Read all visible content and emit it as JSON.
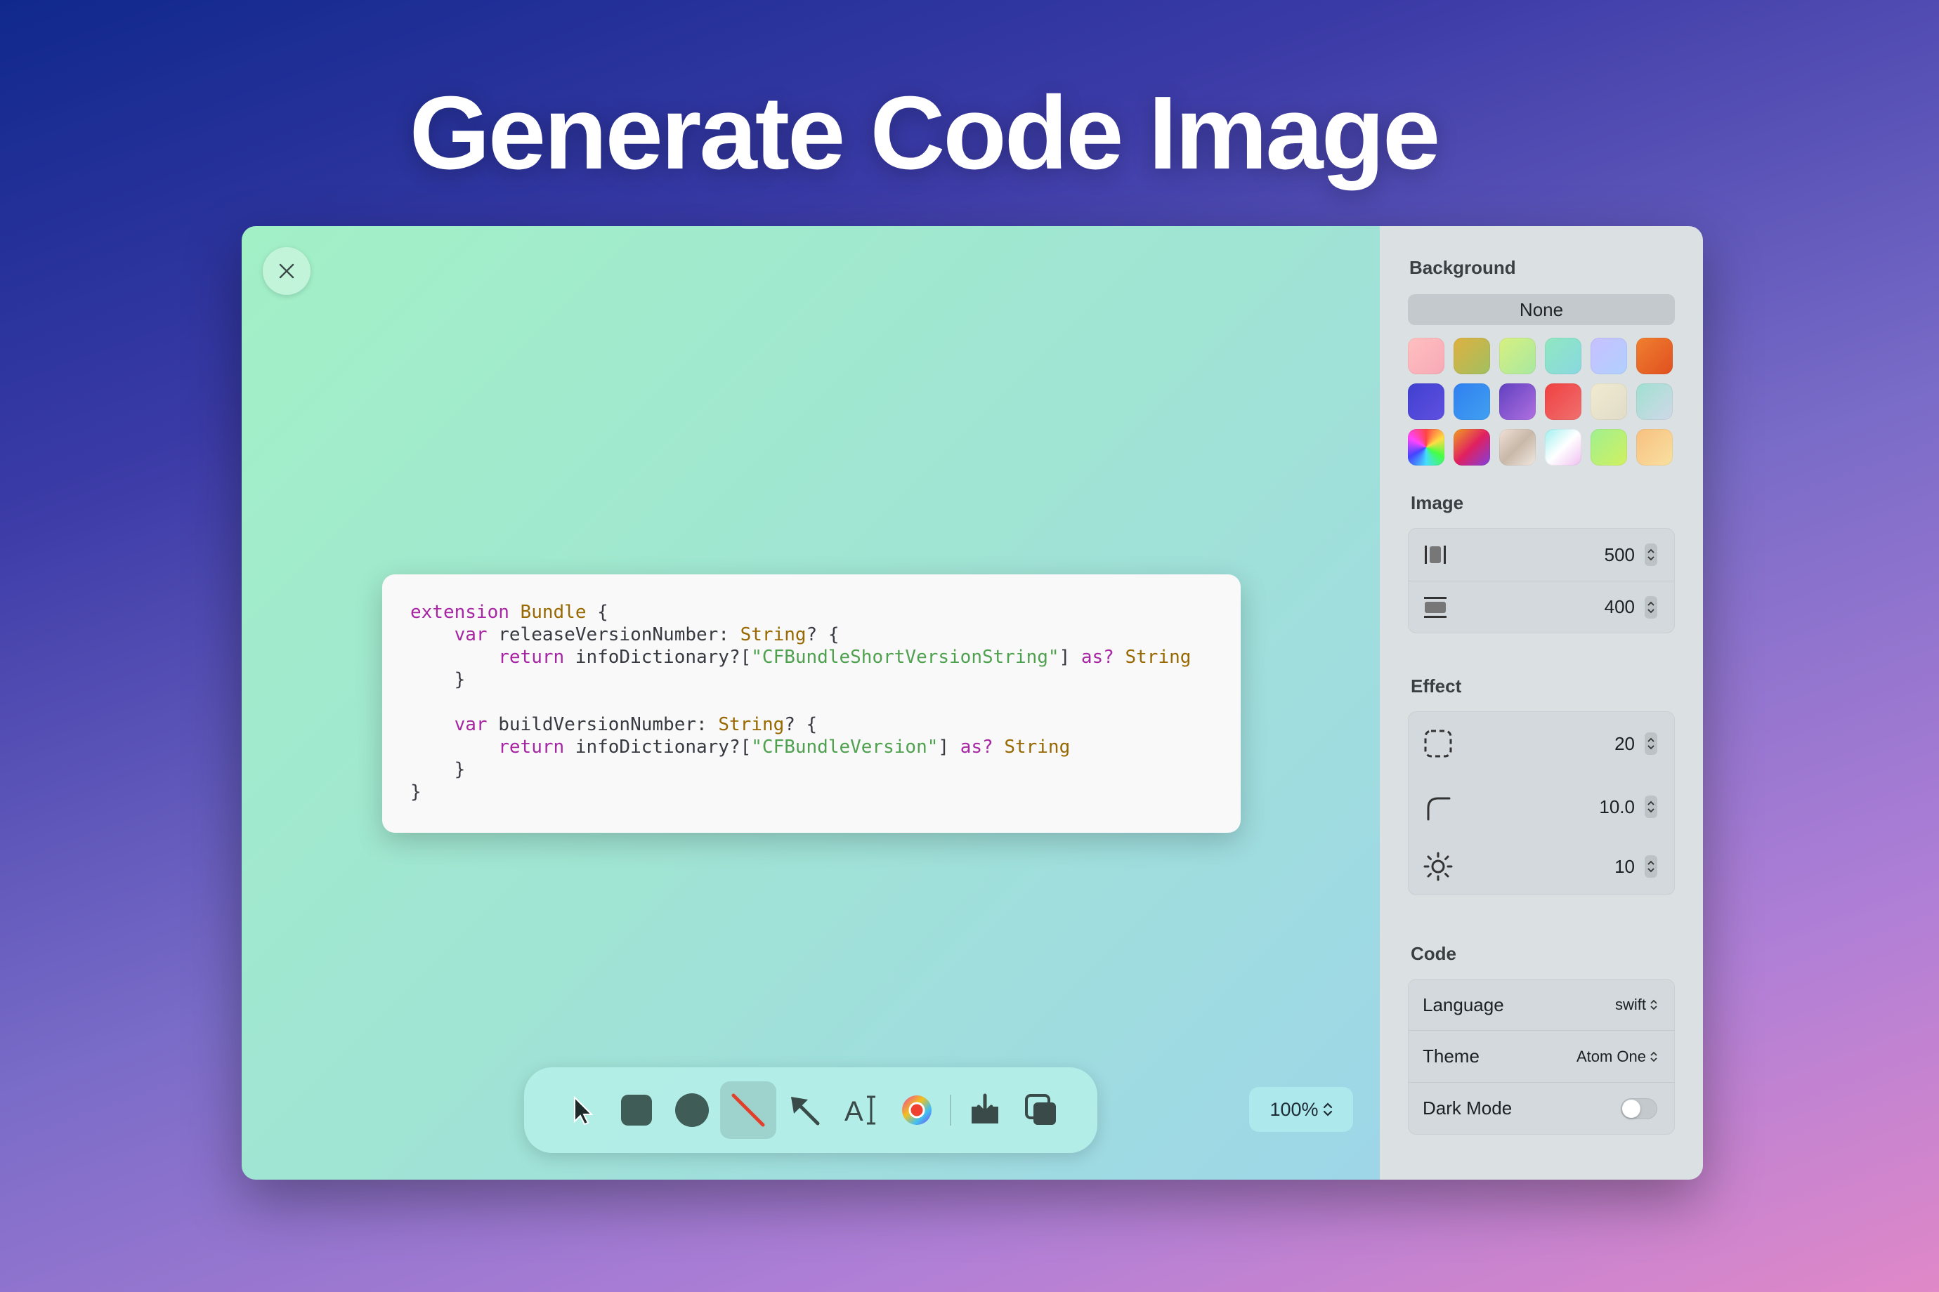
{
  "headline": "Generate Code Image",
  "code_lines": [
    [
      [
        "kw",
        "extension"
      ],
      [
        "p",
        " "
      ],
      [
        "ty",
        "Bundle"
      ],
      [
        "p",
        " {"
      ]
    ],
    [
      [
        "p",
        "    "
      ],
      [
        "kw",
        "var"
      ],
      [
        "p",
        " releaseVersionNumber: "
      ],
      [
        "ty",
        "String"
      ],
      [
        "p",
        "? {"
      ]
    ],
    [
      [
        "p",
        "        "
      ],
      [
        "kw",
        "return"
      ],
      [
        "p",
        " infoDictionary?["
      ],
      [
        "st",
        "\"CFBundleShortVersionString\""
      ],
      [
        "p",
        "] "
      ],
      [
        "kw",
        "as?"
      ],
      [
        "p",
        " "
      ],
      [
        "ty",
        "String"
      ]
    ],
    [
      [
        "p",
        "    }"
      ]
    ],
    [
      [
        "p",
        ""
      ]
    ],
    [
      [
        "p",
        "    "
      ],
      [
        "kw",
        "var"
      ],
      [
        "p",
        " buildVersionNumber: "
      ],
      [
        "ty",
        "String"
      ],
      [
        "p",
        "? {"
      ]
    ],
    [
      [
        "p",
        "        "
      ],
      [
        "kw",
        "return"
      ],
      [
        "p",
        " infoDictionary?["
      ],
      [
        "st",
        "\"CFBundleVersion\""
      ],
      [
        "p",
        "] "
      ],
      [
        "kw",
        "as?"
      ],
      [
        "p",
        " "
      ],
      [
        "ty",
        "String"
      ]
    ],
    [
      [
        "p",
        "    }"
      ]
    ],
    [
      [
        "p",
        "}"
      ]
    ]
  ],
  "toolbar": {
    "tools": [
      "pointer-icon",
      "rectangle-icon",
      "circle-icon",
      "line-icon",
      "arrow-icon",
      "text-icon",
      "color-wheel-icon",
      "download-icon",
      "copy-icon"
    ],
    "active": "line-icon"
  },
  "zoom": {
    "label": "100%"
  },
  "sidebar": {
    "background": {
      "title": "Background",
      "none_label": "None",
      "swatches": [
        "linear-gradient(135deg,#ffc0c0,#f7a9b6)",
        "linear-gradient(135deg,#e0b040,#a0c060)",
        "linear-gradient(135deg,#d8f080,#a8e8a0)",
        "linear-gradient(135deg,#90e8c0,#88d8e0)",
        "linear-gradient(135deg,#c8c0ff,#b0d0ff)",
        "linear-gradient(135deg,#f08030,#e05020)",
        "linear-gradient(135deg,#4040d0,#6050e0)",
        "linear-gradient(135deg,#3080f0,#40a0f0)",
        "linear-gradient(135deg,#6040c0,#b070e0)",
        "linear-gradient(135deg,#f04040,#f07070)",
        "linear-gradient(135deg,#f0ead0,#e0dcc8)",
        "linear-gradient(135deg,#a0e0d0,#d0d8e8)",
        "conic-gradient(#f44,#fd4,#4f4,#4df,#44f,#f4f,#f44)",
        "linear-gradient(135deg,#f0a020,#e02060,#8040e0)",
        "linear-gradient(135deg,#f0e0d8,#c8b8a8,#f0e8e0)",
        "linear-gradient(135deg,#a0f0f0,#fff,#f0c0f0)",
        "linear-gradient(135deg,#a0f090,#d0f060)",
        "linear-gradient(135deg,#f8c080,#f8e0a0)"
      ]
    },
    "image": {
      "title": "Image",
      "width": "500",
      "height": "400"
    },
    "effect": {
      "title": "Effect",
      "padding": "20",
      "radius": "10.0",
      "shadow": "10"
    },
    "code": {
      "title": "Code",
      "language_label": "Language",
      "language_value": "swift",
      "theme_label": "Theme",
      "theme_value": "Atom One",
      "dark_mode_label": "Dark Mode",
      "dark_mode": false
    }
  }
}
